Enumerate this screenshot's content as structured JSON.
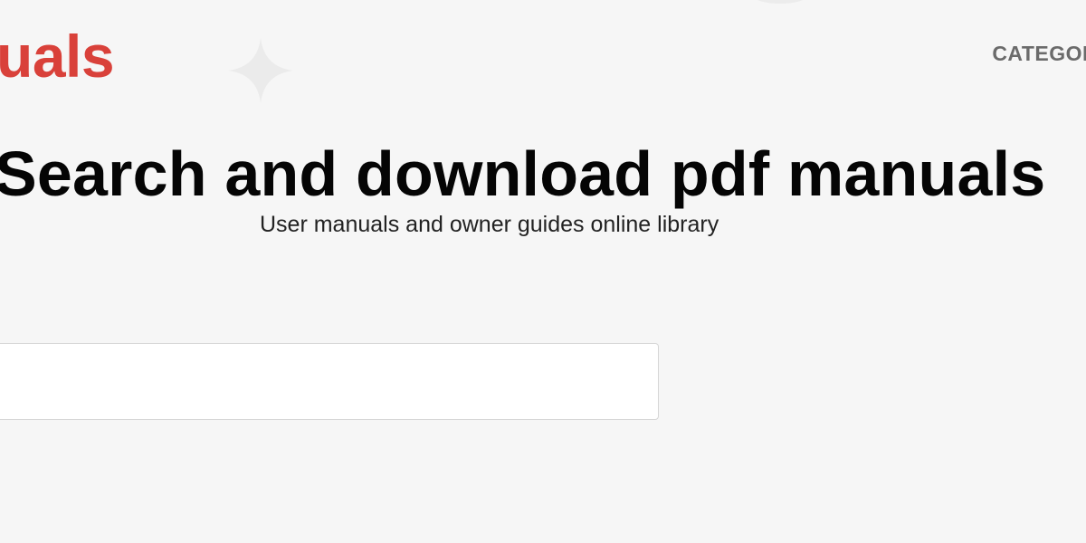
{
  "header": {
    "logo_text": "uals",
    "logo_color": "#d9413a",
    "nav_categories": "CATEGORI"
  },
  "hero": {
    "title": "Search and download pdf manuals",
    "subtitle": "User manuals and owner guides online library"
  },
  "search": {
    "value": "",
    "placeholder": ""
  },
  "icons": {
    "decoration": "diamond-sparkle-icon"
  }
}
